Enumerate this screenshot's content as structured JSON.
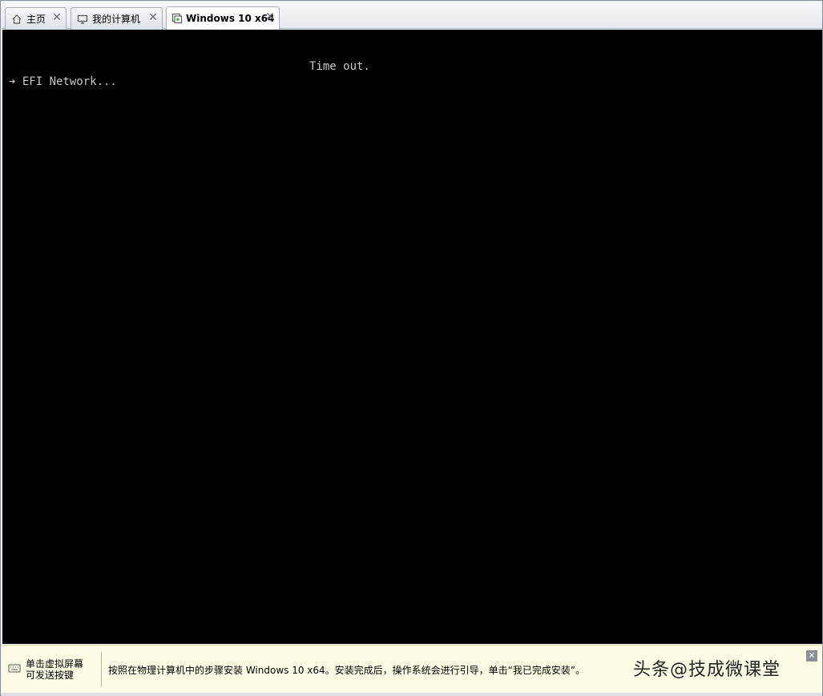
{
  "tabs": [
    {
      "label": "主页",
      "icon": "home-icon"
    },
    {
      "label": "我的计算机",
      "icon": "monitor-icon"
    },
    {
      "label": "Windows 10 x64",
      "icon": "vm-running-icon",
      "active": true
    }
  ],
  "console": {
    "timeout_text": "Time out.",
    "boot_line": "➔ EFI Network..."
  },
  "notification": {
    "hint_line1": "单击虚拟屏幕",
    "hint_line2": "可发送按键",
    "message": "按照在物理计算机中的步骤安装 Windows 10 x64。安装完成后，操作系统会进行引导，单击“我已完成安装”。",
    "watermark": "头条@技成微课堂"
  },
  "colors": {
    "console_bg": "#000000",
    "console_text": "#c8c8c8",
    "notify_bg": "#fffde6"
  }
}
